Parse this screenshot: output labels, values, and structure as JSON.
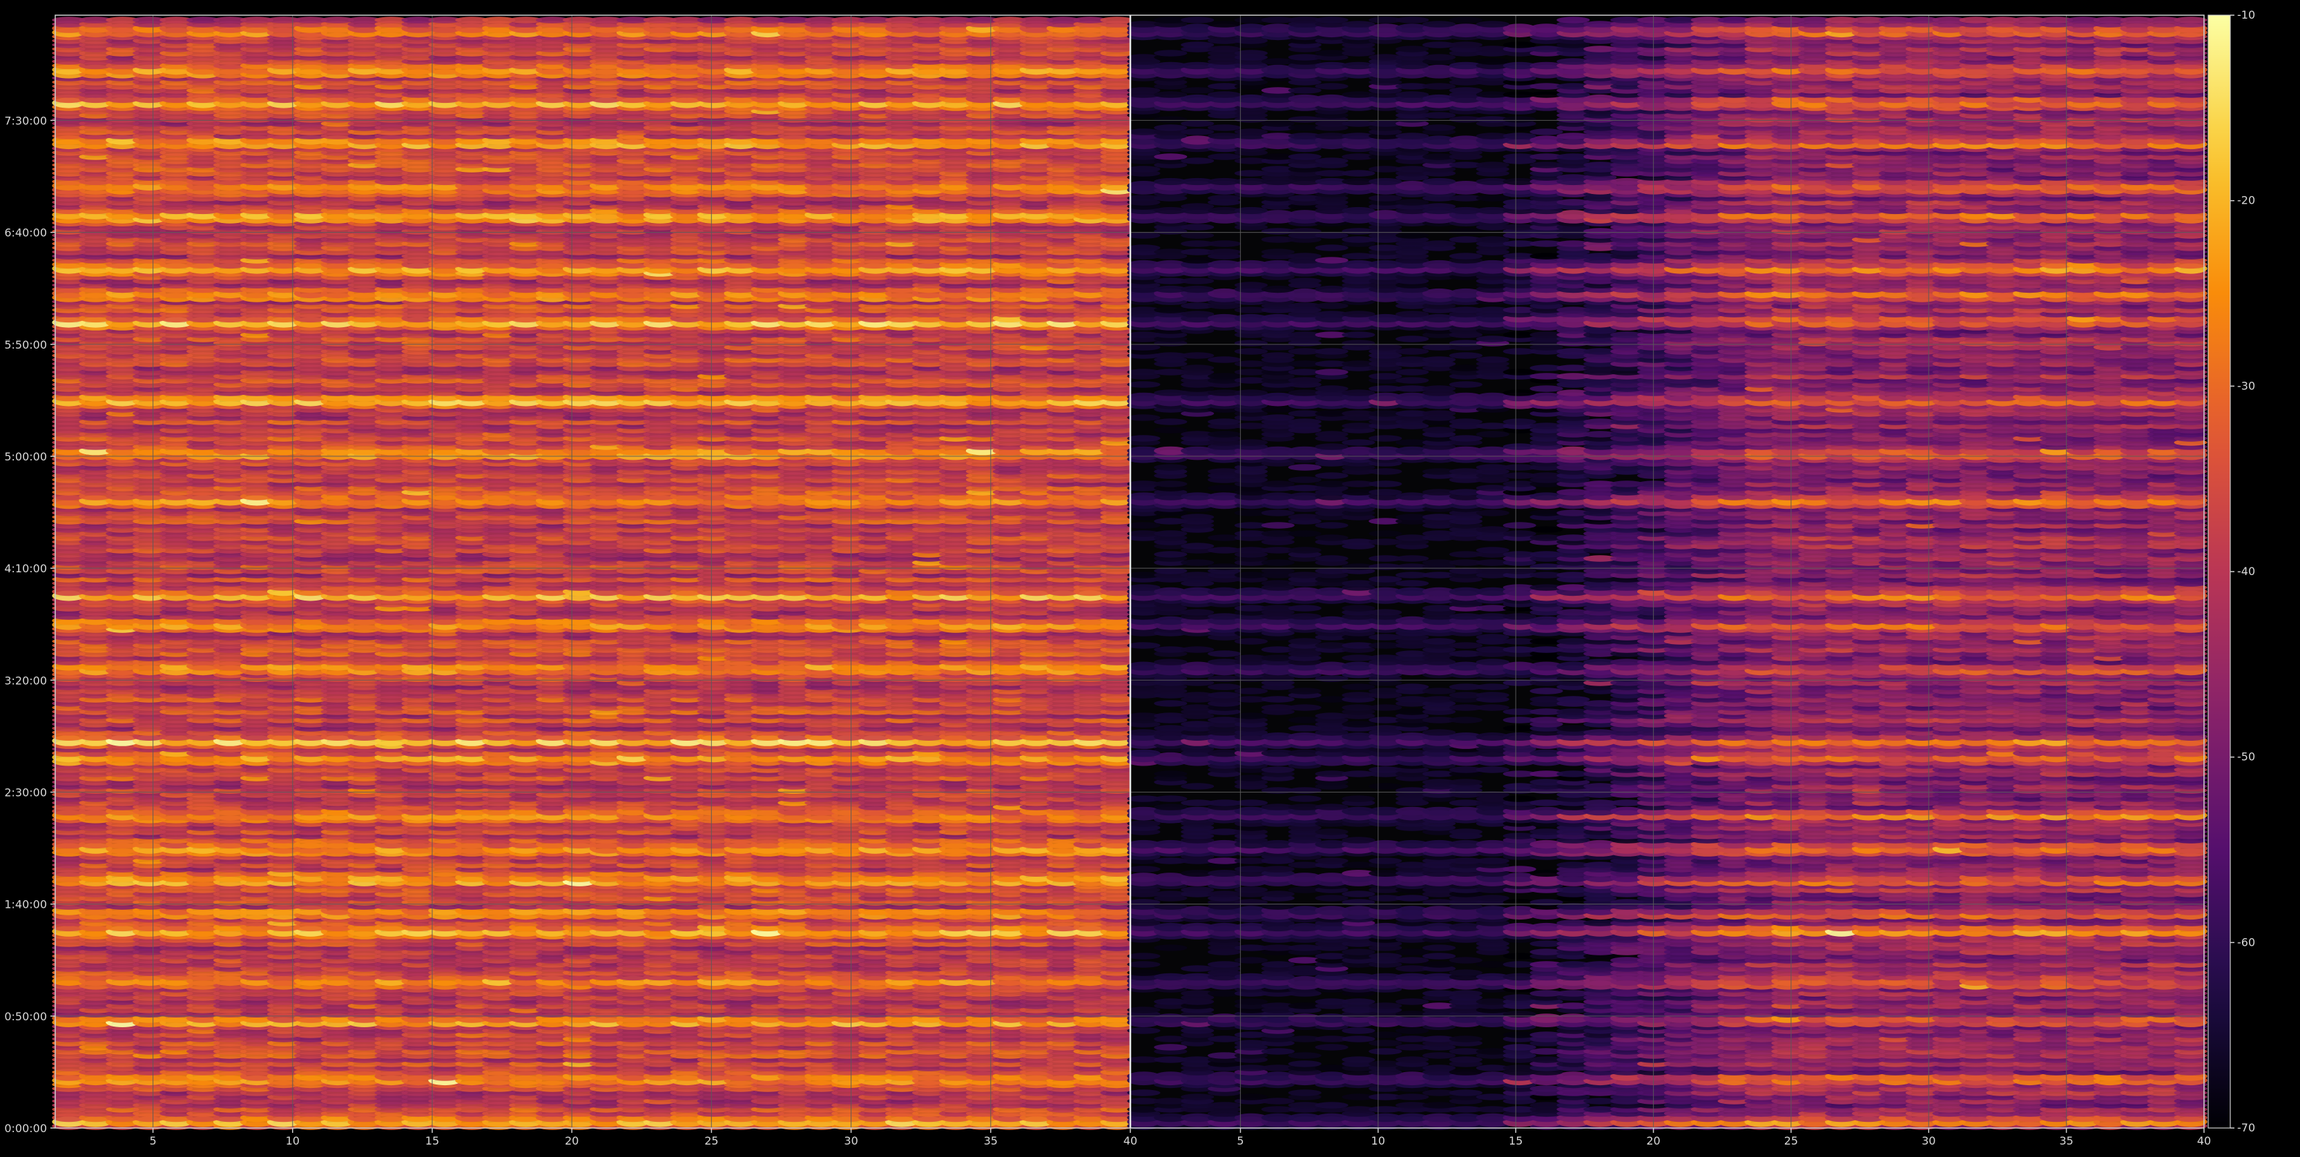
{
  "chart_data": {
    "type": "heatmap",
    "title": "",
    "xlabel": "",
    "ylabel": "",
    "y_tick_labels": [
      "0:00:00",
      "0:50:00",
      "1:40:00",
      "2:30:00",
      "3:20:00",
      "4:10:00",
      "5:00:00",
      "5:50:00",
      "6:40:00",
      "7:30:00"
    ],
    "y_tick_values_min": [
      0,
      50,
      100,
      150,
      200,
      250,
      300,
      350,
      400,
      450
    ],
    "y_range_min": [
      0,
      497
    ],
    "panels": [
      {
        "name": "",
        "x_range": [
          1.5,
          40
        ],
        "x_ticks": [
          5,
          10,
          15,
          20,
          25,
          30,
          35,
          40
        ],
        "base_level_db": -38,
        "left_fraction": 0,
        "right_fraction": 1
      },
      {
        "name": "",
        "x_range": [
          1,
          40
        ],
        "x_ticks": [
          5,
          10,
          15,
          20,
          25,
          30,
          35,
          40
        ],
        "base_level_db": -68,
        "left_fraction": 0.35,
        "right_fraction": 1
      }
    ],
    "bright_rows_min": [
      3,
      22,
      48,
      65,
      88,
      96,
      111,
      125,
      140,
      165,
      173,
      205,
      225,
      238,
      280,
      301,
      325,
      360,
      372,
      384,
      407,
      420,
      440,
      458,
      472,
      490
    ],
    "colorbar": {
      "colormap": "inferno",
      "range": [
        -70,
        -10
      ],
      "ticks": [
        -10,
        -20,
        -30,
        -40,
        -50,
        -60,
        -70
      ],
      "tick_labels": [
        "-10",
        "-20",
        "-30",
        "-40",
        "-50",
        "-60",
        "-70"
      ]
    },
    "grid": true,
    "colors": {
      "background": "#000000",
      "grid": "#5a5a5a",
      "text": "#d8d8d8",
      "spine": "#cfcfcf"
    }
  }
}
